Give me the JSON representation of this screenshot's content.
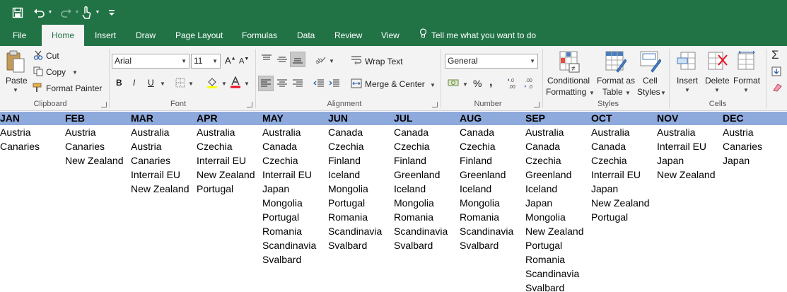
{
  "tabs": [
    {
      "label": "File",
      "active": false
    },
    {
      "label": "Home",
      "active": true
    },
    {
      "label": "Insert",
      "active": false
    },
    {
      "label": "Draw",
      "active": false
    },
    {
      "label": "Page Layout",
      "active": false
    },
    {
      "label": "Formulas",
      "active": false
    },
    {
      "label": "Data",
      "active": false
    },
    {
      "label": "Review",
      "active": false
    },
    {
      "label": "View",
      "active": false
    }
  ],
  "tell_me": "Tell me what you want to do",
  "ribbon": {
    "clipboard": {
      "paste": "Paste",
      "cut": "Cut",
      "copy": "Copy",
      "format_painter": "Format Painter",
      "label": "Clipboard"
    },
    "font": {
      "name": "Arial",
      "size": "11",
      "bold": "B",
      "italic": "I",
      "underline": "U",
      "label": "Font"
    },
    "alignment": {
      "wrap_text": "Wrap Text",
      "merge_center": "Merge & Center",
      "label": "Alignment"
    },
    "number": {
      "format": "General",
      "percent": "%",
      "comma": ",",
      "label": "Number"
    },
    "styles": {
      "conditional_1": "Conditional",
      "conditional_2": "Formatting",
      "format_table_1": "Format as",
      "format_table_2": "Table",
      "cell_styles_1": "Cell",
      "cell_styles_2": "Styles",
      "label": "Styles"
    },
    "cells": {
      "insert": "Insert",
      "delete": "Delete",
      "format": "Format",
      "label": "Cells"
    }
  },
  "colors": {
    "title_bar": "#217346",
    "header_band": "#8ea9db",
    "font_color": "#e81123"
  },
  "sheet": {
    "months": [
      {
        "name": "JAN",
        "items": [
          "Austria",
          "Canaries"
        ]
      },
      {
        "name": "FEB",
        "items": [
          "Austria",
          "Canaries",
          "New Zealand"
        ]
      },
      {
        "name": "MAR",
        "items": [
          "Australia",
          "Austria",
          "Canaries",
          "Interrail EU",
          "New Zealand"
        ]
      },
      {
        "name": "APR",
        "items": [
          "Australia",
          "Czechia",
          "Interrail EU",
          "New Zealand",
          "Portugal"
        ]
      },
      {
        "name": "MAY",
        "items": [
          "Australia",
          "Canada",
          "Czechia",
          "Interrail EU",
          "Japan",
          "Mongolia",
          "Portugal",
          "Romania",
          "Scandinavia",
          "Svalbard"
        ]
      },
      {
        "name": "JUN",
        "items": [
          "Canada",
          "Czechia",
          "Finland",
          "Iceland",
          "Mongolia",
          "Portugal",
          "Romania",
          "Scandinavia",
          "Svalbard"
        ]
      },
      {
        "name": "JUL",
        "items": [
          "Canada",
          "Czechia",
          "Finland",
          "Greenland",
          "Iceland",
          "Mongolia",
          "Romania",
          "Scandinavia",
          "Svalbard"
        ]
      },
      {
        "name": "AUG",
        "items": [
          "Canada",
          "Czechia",
          "Finland",
          "Greenland",
          "Iceland",
          "Mongolia",
          "Romania",
          "Scandinavia",
          "Svalbard"
        ]
      },
      {
        "name": "SEP",
        "items": [
          "Australia",
          "Canada",
          "Czechia",
          "Greenland",
          "Iceland",
          "Japan",
          "Mongolia",
          "New Zealand",
          "Portugal",
          "Romania",
          "Scandinavia",
          "Svalbard"
        ]
      },
      {
        "name": "OCT",
        "items": [
          "Australia",
          "Canada",
          "Czechia",
          "Interrail EU",
          "Japan",
          "New Zealand",
          "Portugal"
        ]
      },
      {
        "name": "NOV",
        "items": [
          "Australia",
          "Interrail EU",
          "Japan",
          "New Zealand"
        ]
      },
      {
        "name": "DEC",
        "items": [
          "Austria",
          "Canaries",
          "Japan"
        ]
      }
    ]
  }
}
